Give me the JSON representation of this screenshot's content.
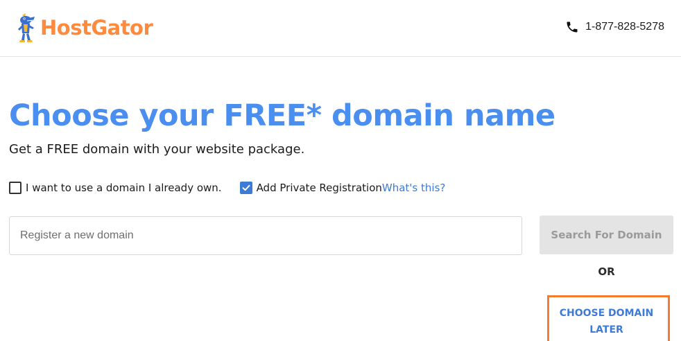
{
  "header": {
    "brand": "HostGator",
    "mascot_icon": "gator-mascot-icon",
    "phone_icon": "phone-icon",
    "phone_number": "1-877-828-5278"
  },
  "main": {
    "title": "Choose your FREE* domain name",
    "subtitle": "Get a FREE domain with your website package.",
    "options": {
      "own_domain_label": "I want to use a domain I already own.",
      "own_domain_checked": false,
      "private_reg_label": "Add Private Registration",
      "private_reg_checked": true,
      "whats_this_label": "What's this?"
    },
    "search": {
      "placeholder": "Register a new domain",
      "value": "",
      "button_label": "Search For Domain"
    },
    "or_label": "OR",
    "choose_later_label": "CHOOSE DOMAIN LATER"
  },
  "colors": {
    "brand_orange": "#ff8a3d",
    "title_blue": "#4a8ef0",
    "link_blue": "#3d7bd5",
    "highlight_orange": "#f47c30",
    "button_disabled_bg": "#e4e4e4"
  }
}
